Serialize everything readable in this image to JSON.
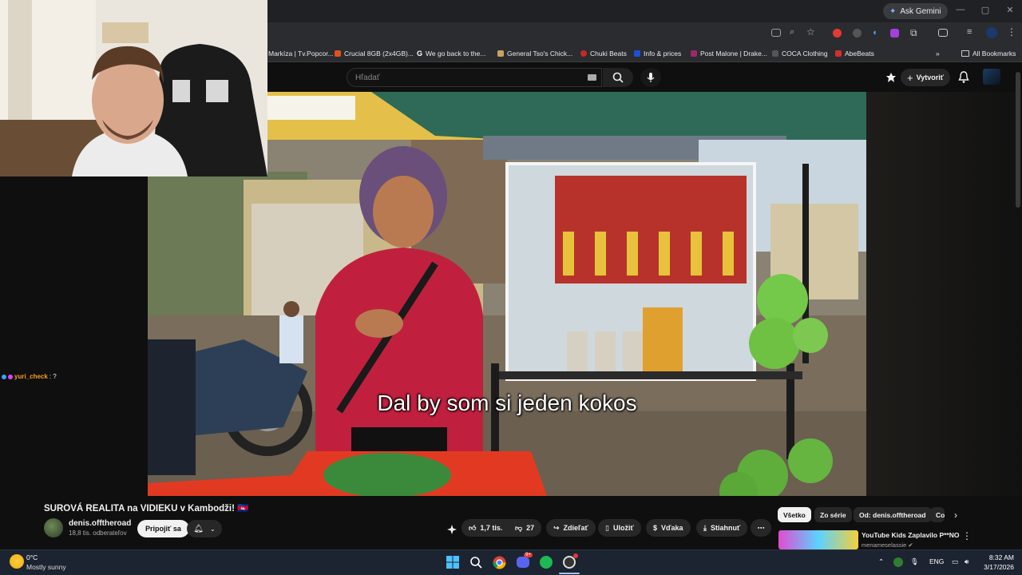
{
  "browser": {
    "gemini_label": "Ask Gemini",
    "bookmarks": [
      {
        "label": "Markíza | Tv.Popcor...",
        "color": "#2b2c30"
      },
      {
        "label": "Crucial 8GB (2x4GB)...",
        "color": "#e0531f"
      },
      {
        "label": "We go back to the...",
        "color": "#4285f4"
      },
      {
        "label": "General Tso's Chick...",
        "color": "#c8a35c"
      },
      {
        "label": "Chuki Beats",
        "color": "#c62828"
      },
      {
        "label": "Info & prices",
        "color": "#1e4fd8"
      },
      {
        "label": "Post Malone | Drake...",
        "color": "#9b2a6c"
      },
      {
        "label": "COCA Clothing",
        "color": "#444"
      },
      {
        "label": "AbeBeats",
        "color": "#d32f2f"
      }
    ],
    "all_bookmarks": "All Bookmarks"
  },
  "youtube": {
    "search_placeholder": "Hľadať",
    "create_label": "Vytvoriť",
    "subtitle": "Dal by som si jeden kokos",
    "video_title": "SUROVÁ REALITA na VIDIEKU v Kambodži! 🇰🇭",
    "channel": {
      "name": "denis.offtheroad",
      "subs": "18,8 tis. odberateľov"
    },
    "join_label": "Pripojiť sa",
    "actions": {
      "likes": "1,7 tis.",
      "dislikes": "27",
      "share": "Zdieľať",
      "save": "Uložiť",
      "thanks": "Vďaka",
      "download": "Stiahnuť"
    },
    "chips": [
      "Všetko",
      "Zo série",
      "Od: denis.offtheroad",
      "Co"
    ],
    "recommendation": {
      "title": "YouTube Kids Zaplavilo P**NO",
      "channel": "menameselassie"
    }
  },
  "chat": {
    "user": "yuri_check",
    "message": ": ?"
  },
  "taskbar": {
    "weather_temp": "0°C",
    "weather_desc": "Mostly sunny",
    "lang": "ENG",
    "time": "8:32 AM",
    "date": "3/17/2026"
  }
}
